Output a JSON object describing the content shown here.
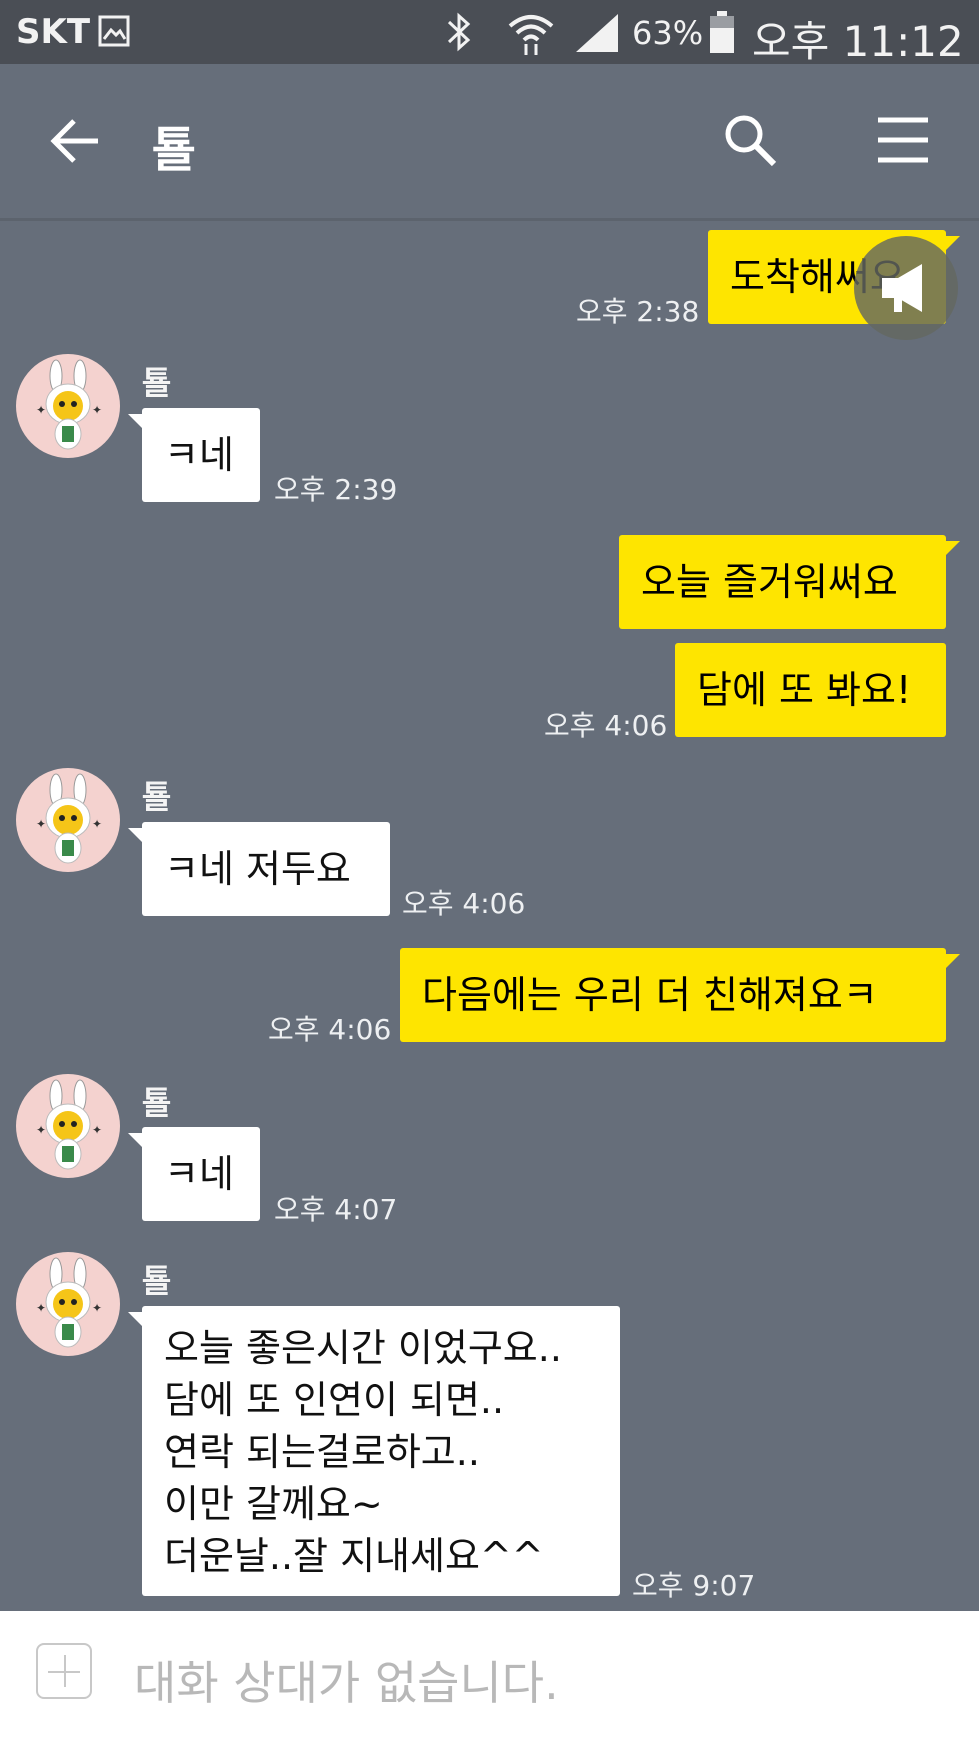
{
  "status_bar": {
    "carrier": "SKT",
    "battery": "63%",
    "time": "오후 11:12"
  },
  "header": {
    "title": "툘",
    "back_icon": "arrow-left-icon",
    "search_icon": "search-icon",
    "menu_icon": "hamburger-menu-icon"
  },
  "messages": [
    {
      "from": "me",
      "text": "도착해써요",
      "time": "오후 2:38"
    },
    {
      "from": "other",
      "sender": "툘",
      "text": "ㅋ네",
      "time": "오후 2:39"
    },
    {
      "from": "me",
      "text": "오늘 즐거워써요"
    },
    {
      "from": "me",
      "text": "담에 또 봐요!",
      "time": "오후 4:06"
    },
    {
      "from": "other",
      "sender": "툘",
      "text": "ㅋ네 저두요",
      "time": "오후 4:06"
    },
    {
      "from": "me",
      "text": "다음에는 우리 더 친해져요ㅋ",
      "time": "오후 4:06"
    },
    {
      "from": "other",
      "sender": "툘",
      "text": "ㅋ네",
      "time": "오후 4:07"
    },
    {
      "from": "other",
      "sender": "툘",
      "lines": [
        "오늘 좋은시간 이었구요..",
        "담에 또 인연이 되면..",
        "연락 되는걸로하고..",
        "이만 갈께요~",
        "더운날..잘 지내세요^^"
      ],
      "time": "오후 9:07"
    }
  ],
  "input": {
    "placeholder": "대화 상대가 없습니다.",
    "plus_icon": "plus-icon"
  },
  "colors": {
    "chat_background": "#666e7a",
    "my_bubble": "#fee500",
    "their_bubble": "#ffffff",
    "status_bar": "#4a4e55"
  }
}
